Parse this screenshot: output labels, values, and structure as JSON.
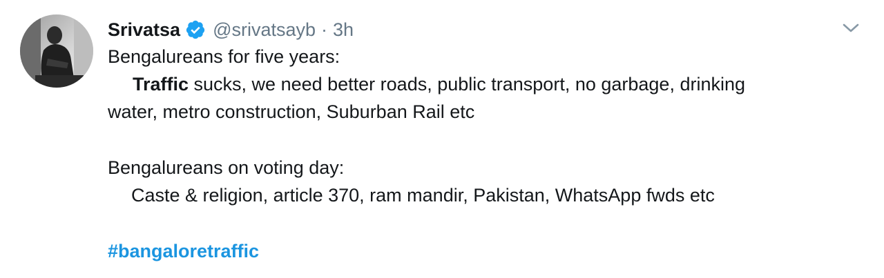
{
  "tweet": {
    "name": "Srivatsa",
    "handle": "@srivatsayb",
    "separator": "·",
    "time": "3h",
    "verified_icon": "verified-badge-icon",
    "menu_icon": "chevron-down-icon",
    "lines": {
      "l1": "Bengalureans for five years:",
      "l2_bold": "Traffic",
      "l2_rest": " sucks, we need better roads, public transport, no garbage, drinking",
      "l3": "water, metro construction, Suburban Rail etc",
      "l4": "Bengalureans on voting day:",
      "l5": "Caste & religion, article 370, ram mandir, Pakistan, WhatsApp fwds etc"
    },
    "hashtag": "#bangaloretraffic",
    "colors": {
      "link": "#1b95e0",
      "verified": "#1da1f2",
      "muted": "#657786"
    }
  }
}
